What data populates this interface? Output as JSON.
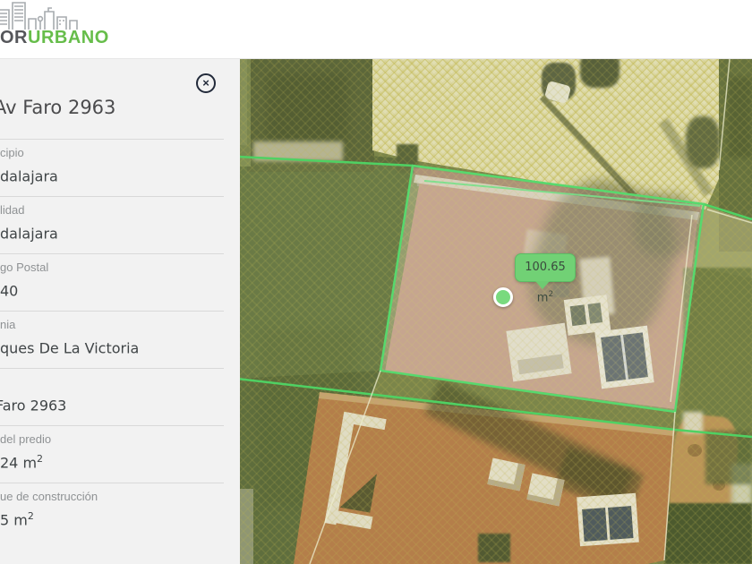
{
  "header": {
    "logo_gray": "OR",
    "logo_green": "URBANO"
  },
  "panel": {
    "title": "Av Faro 2963",
    "close_glyph": "×",
    "fields": [
      {
        "label": "cipio",
        "value": "dalajara",
        "sup": ""
      },
      {
        "label": "lidad",
        "value": "dalajara",
        "sup": ""
      },
      {
        "label": "go Postal",
        "value": "40",
        "sup": ""
      },
      {
        "label": "nia",
        "value": "ques De La Victoria",
        "sup": ""
      },
      {
        "label": "",
        "value": "Faro 2963",
        "sup": ""
      },
      {
        "label": "del predio",
        "value": "24 m",
        "sup": "2"
      },
      {
        "label": "ue de construcción",
        "value": "5 m",
        "sup": "2"
      }
    ]
  },
  "map": {
    "area_chip": {
      "value": "100.65 m",
      "sup": "2"
    },
    "colors": {
      "parcel_outline": "#57d96d",
      "boundary_line": "#4fd163",
      "chip_bg": "#71d175",
      "marker_fill": "#79da7e",
      "brand_green": "#66bd4a"
    }
  }
}
